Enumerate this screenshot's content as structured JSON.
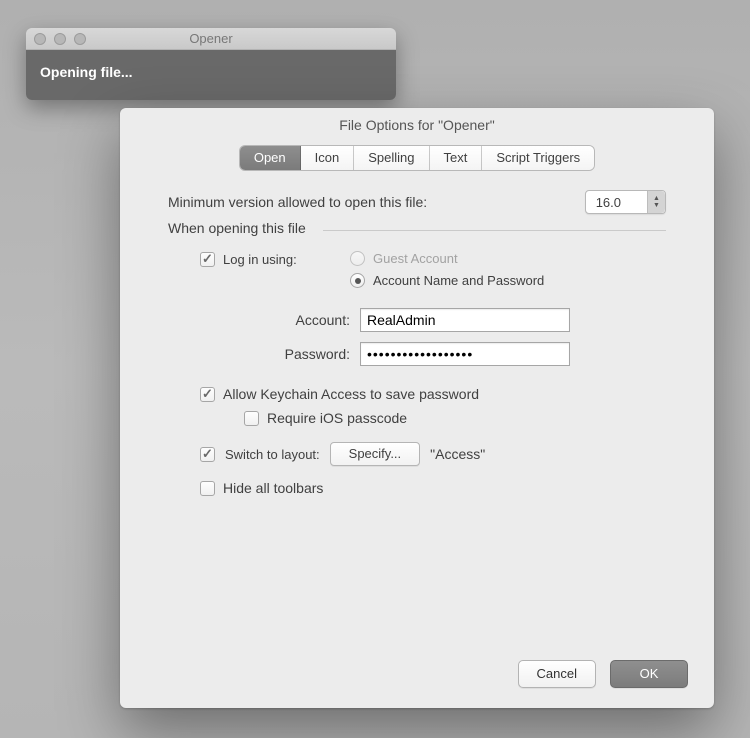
{
  "bg_window": {
    "title": "Opener",
    "status": "Opening file..."
  },
  "dialog": {
    "title": "File Options for \"Opener\"",
    "tabs": [
      "Open",
      "Icon",
      "Spelling",
      "Text",
      "Script Triggers"
    ],
    "active_tab": "Open",
    "min_version_label": "Minimum version allowed to open this file:",
    "min_version_value": "16.0",
    "when_opening_label": "When opening this file",
    "login_using_label": "Log in using:",
    "login_using_checked": true,
    "guest_label": "Guest Account",
    "accountpw_label": "Account Name and Password",
    "login_mode": "accountpw",
    "account_label": "Account:",
    "account_value": "RealAdmin",
    "password_label": "Password:",
    "password_value": "••••••••••••••••••",
    "keychain_label": "Allow Keychain Access to save password",
    "keychain_checked": true,
    "ios_passcode_label": "Require iOS passcode",
    "ios_passcode_checked": false,
    "switch_layout_label": "Switch to layout:",
    "switch_layout_checked": true,
    "specify_label": "Specify...",
    "layout_name": "\"Access\"",
    "hide_toolbars_label": "Hide all toolbars",
    "hide_toolbars_checked": false,
    "cancel": "Cancel",
    "ok": "OK"
  }
}
